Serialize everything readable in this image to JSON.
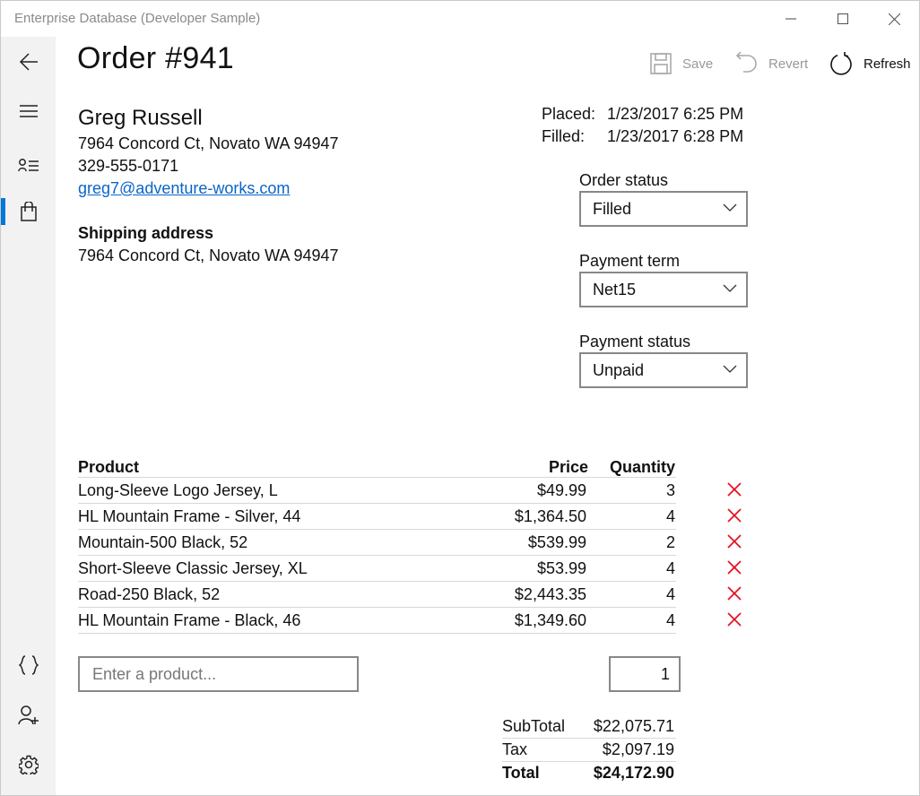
{
  "window": {
    "title": "Enterprise Database (Developer Sample)"
  },
  "nav": {
    "items": [
      {
        "icon": "back-arrow-icon"
      },
      {
        "icon": "hamburger-menu-icon"
      },
      {
        "icon": "customers-list-icon"
      },
      {
        "icon": "orders-bag-icon",
        "selected": true
      },
      {
        "icon": "code-braces-icon"
      },
      {
        "icon": "add-user-icon"
      },
      {
        "icon": "gear-icon"
      }
    ],
    "accent": "#0078d7"
  },
  "header": {
    "title": "Order #941",
    "commands": {
      "save": "Save",
      "revert": "Revert",
      "refresh": "Refresh"
    }
  },
  "customer": {
    "name": "Greg Russell",
    "address": "7964 Concord Ct, Novato WA 94947",
    "phone": "329-555-0171",
    "email": "greg7@adventure-works.com",
    "shipping_label": "Shipping address",
    "shipping_address": "7964 Concord Ct, Novato WA 94947"
  },
  "dates": {
    "placed_label": "Placed:",
    "placed_value": "1/23/2017 6:25 PM",
    "filled_label": "Filled:",
    "filled_value": "1/23/2017 6:28 PM"
  },
  "fields": {
    "order_status": {
      "label": "Order status",
      "value": "Filled"
    },
    "payment_term": {
      "label": "Payment term",
      "value": "Net15"
    },
    "payment_status": {
      "label": "Payment status",
      "value": "Unpaid"
    }
  },
  "table": {
    "headers": {
      "product": "Product",
      "price": "Price",
      "quantity": "Quantity"
    },
    "rows": [
      {
        "product": "Long-Sleeve Logo Jersey, L",
        "price": "$49.99",
        "quantity": "3"
      },
      {
        "product": "HL Mountain Frame - Silver, 44",
        "price": "$1,364.50",
        "quantity": "4"
      },
      {
        "product": "Mountain-500 Black, 52",
        "price": "$539.99",
        "quantity": "2"
      },
      {
        "product": "Short-Sleeve Classic Jersey, XL",
        "price": "$53.99",
        "quantity": "4"
      },
      {
        "product": "Road-250 Black, 52",
        "price": "$2,443.35",
        "quantity": "4"
      },
      {
        "product": "HL Mountain Frame - Black, 46",
        "price": "$1,349.60",
        "quantity": "4"
      }
    ],
    "delete_color": "#e81123"
  },
  "add_line": {
    "product_placeholder": "Enter a product...",
    "quantity_value": "1"
  },
  "totals": {
    "subtotal_label": "SubTotal",
    "subtotal_value": "$22,075.71",
    "tax_label": "Tax",
    "tax_value": "$2,097.19",
    "total_label": "Total",
    "total_value": "$24,172.90"
  }
}
